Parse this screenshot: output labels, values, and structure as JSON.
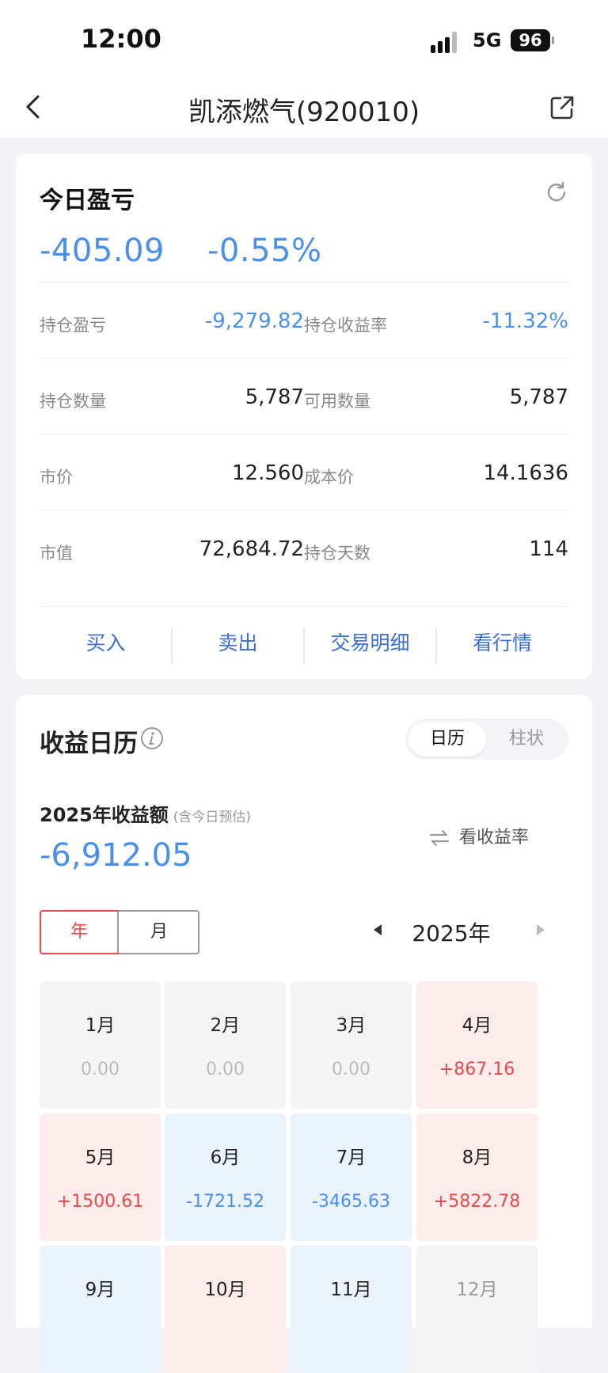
{
  "status_bar": {
    "time": "12:00",
    "network": "5G",
    "battery": "96"
  },
  "nav": {
    "title": "凯添燃气(920010)"
  },
  "today": {
    "title": "今日盈亏",
    "pnl": "-405.09",
    "pct": "-0.55%"
  },
  "stats": [
    {
      "l_label": "持仓盈亏",
      "l_value": "-9,279.82",
      "r_label": "持仓收益率",
      "r_value": "-11.32%"
    },
    {
      "l_label": "持仓数量",
      "l_value": "5,787",
      "r_label": "可用数量",
      "r_value": "5,787"
    },
    {
      "l_label": "市价",
      "l_value": "12.560",
      "r_label": "成本价",
      "r_value": "14.1636"
    },
    {
      "l_label": "市值",
      "l_value": "72,684.72",
      "r_label": "持仓天数",
      "r_value": "114"
    }
  ],
  "actions": {
    "buy": "买入",
    "sell": "卖出",
    "details": "交易明细",
    "quote": "看行情"
  },
  "calendar": {
    "title": "收益日历",
    "tab_calendar": "日历",
    "tab_bar": "柱状",
    "year_label": "2025年收益额",
    "year_note": "(含今日预估)",
    "rate_link": "看收益率",
    "year_total": "-6,912.05",
    "toggle_year": "年",
    "toggle_month": "月",
    "current_year": "2025年",
    "months": [
      {
        "name": "1月",
        "value": "0.00"
      },
      {
        "name": "2月",
        "value": "0.00"
      },
      {
        "name": "3月",
        "value": "0.00"
      },
      {
        "name": "4月",
        "value": "+867.16"
      },
      {
        "name": "5月",
        "value": "+1500.61"
      },
      {
        "name": "6月",
        "value": "-1721.52"
      },
      {
        "name": "7月",
        "value": "-3465.63"
      },
      {
        "name": "8月",
        "value": "+5822.78"
      },
      {
        "name": "9月",
        "value": ""
      },
      {
        "name": "10月",
        "value": ""
      },
      {
        "name": "11月",
        "value": ""
      },
      {
        "name": "12月",
        "value": ""
      }
    ]
  },
  "colors": {
    "gain": "#e84a4a",
    "loss": "#4a90e8",
    "accent": "#3b6fd4"
  }
}
